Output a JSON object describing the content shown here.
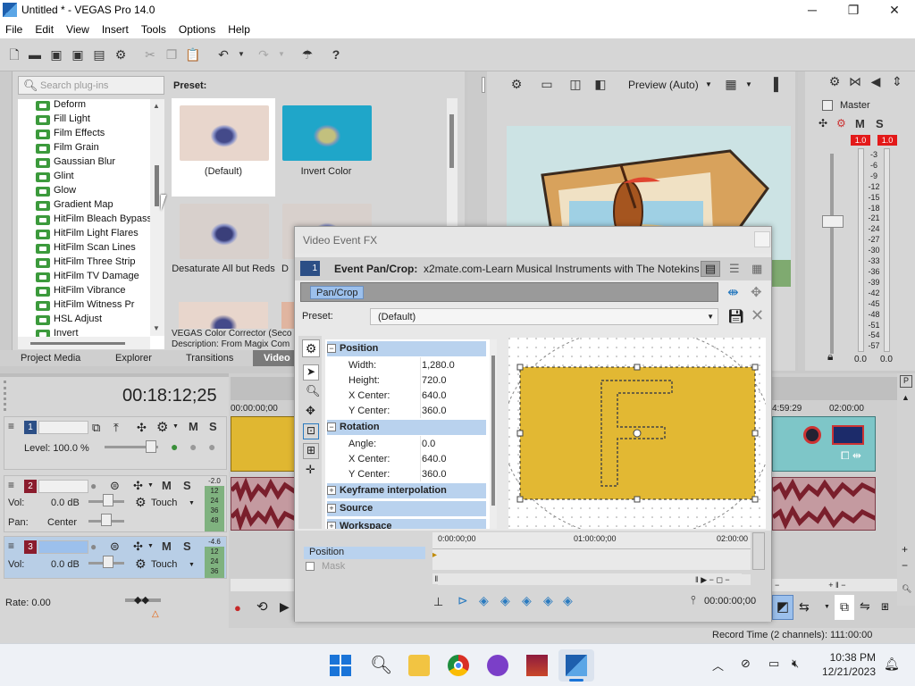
{
  "window": {
    "title": "Untitled * - VEGAS Pro 14.0",
    "minimize": "─",
    "maximize": "❐",
    "close": "✕"
  },
  "menu": [
    "File",
    "Edit",
    "View",
    "Insert",
    "Tools",
    "Options",
    "Help"
  ],
  "plugins": {
    "search_placeholder": "Search plug-ins",
    "items": [
      "Deform",
      "Fill Light",
      "Film Effects",
      "Film Grain",
      "Gaussian Blur",
      "Glint",
      "Glow",
      "Gradient Map",
      "HitFilm Bleach Bypass",
      "HitFilm Light Flares",
      "HitFilm Scan Lines",
      "HitFilm Three Strip",
      "HitFilm TV Damage",
      "HitFilm Vibrance",
      "HitFilm Witness Pr",
      "HSL Adjust",
      "Invert"
    ],
    "preset_label": "Preset:",
    "presets": [
      {
        "name": "(Default)"
      },
      {
        "name": "Invert Color"
      },
      {
        "name": "Desaturate All but Reds"
      },
      {
        "name": "D"
      }
    ],
    "desc_line1": "VEGAS Color Corrector (Seco",
    "desc_line2": "Description: From Magix Com"
  },
  "window_tabs": [
    "Project Media",
    "Explorer",
    "Transitions",
    "Video"
  ],
  "preview": {
    "mode": "Preview (Auto)"
  },
  "mixer": {
    "label": "Master",
    "peak_left": "1.0",
    "peak_right": "1.0",
    "scale": [
      "3",
      "6",
      "9",
      "12",
      "15",
      "18",
      "21",
      "24",
      "27",
      "30",
      "33",
      "36",
      "39",
      "42",
      "45",
      "48",
      "51",
      "54",
      "57"
    ],
    "out_left": "0.0",
    "out_right": "0.0"
  },
  "timeline": {
    "timecode": "00:18:12;25",
    "ruler_start": "00:00:00;00",
    "ruler_mid": "4:59:29",
    "ruler_end": "02:00:00",
    "tracks": [
      {
        "num": "1",
        "level": "Level: 100.0 %"
      },
      {
        "num": "2",
        "vol_label": "Vol:",
        "vol": "0.0 dB",
        "pan_label": "Pan:",
        "pan": "Center",
        "mode": "Touch",
        "meter": [
          "-2.0",
          "12",
          "24",
          "36",
          "48"
        ]
      },
      {
        "num": "3",
        "vol_label": "Vol:",
        "vol": "0.0 dB",
        "mode": "Touch",
        "meter": [
          "-4.6",
          "12",
          "24",
          "36"
        ]
      }
    ],
    "rate": "Rate: 0.00"
  },
  "fx": {
    "title": "Video Event FX",
    "chain_index": "1",
    "plugin_label": "Event Pan/Crop:",
    "clip_name": "x2mate.com-Learn Musical Instruments with The Notekins _ 2",
    "chain_chip": "Pan/Crop",
    "preset_label": "Preset:",
    "preset_value": "(Default)",
    "groups": {
      "position": "Position",
      "rotation": "Rotation",
      "keyframe": "Keyframe interpolation",
      "source": "Source",
      "workspace": "Workspace"
    },
    "position_rows": [
      {
        "k": "Width:",
        "v": "1,280.0"
      },
      {
        "k": "Height:",
        "v": "720.0"
      },
      {
        "k": "X Center:",
        "v": "640.0"
      },
      {
        "k": "Y Center:",
        "v": "360.0"
      }
    ],
    "rotation_rows": [
      {
        "k": "Angle:",
        "v": "0.0"
      },
      {
        "k": "X Center:",
        "v": "640.0"
      },
      {
        "k": "Y Center:",
        "v": "360.0"
      }
    ],
    "crop_letter": "F",
    "kf_tracks": [
      "Position",
      "Mask"
    ],
    "kf_ruler": [
      "0:00:00;00",
      "01:00:00;00",
      "02:00:00"
    ],
    "kf_time": "00:00:00;00"
  },
  "status": {
    "record_time": "Record Time (2 channels): 111:00:00"
  },
  "taskbar": {
    "time": "10:38 PM",
    "date": "12/21/2023"
  }
}
